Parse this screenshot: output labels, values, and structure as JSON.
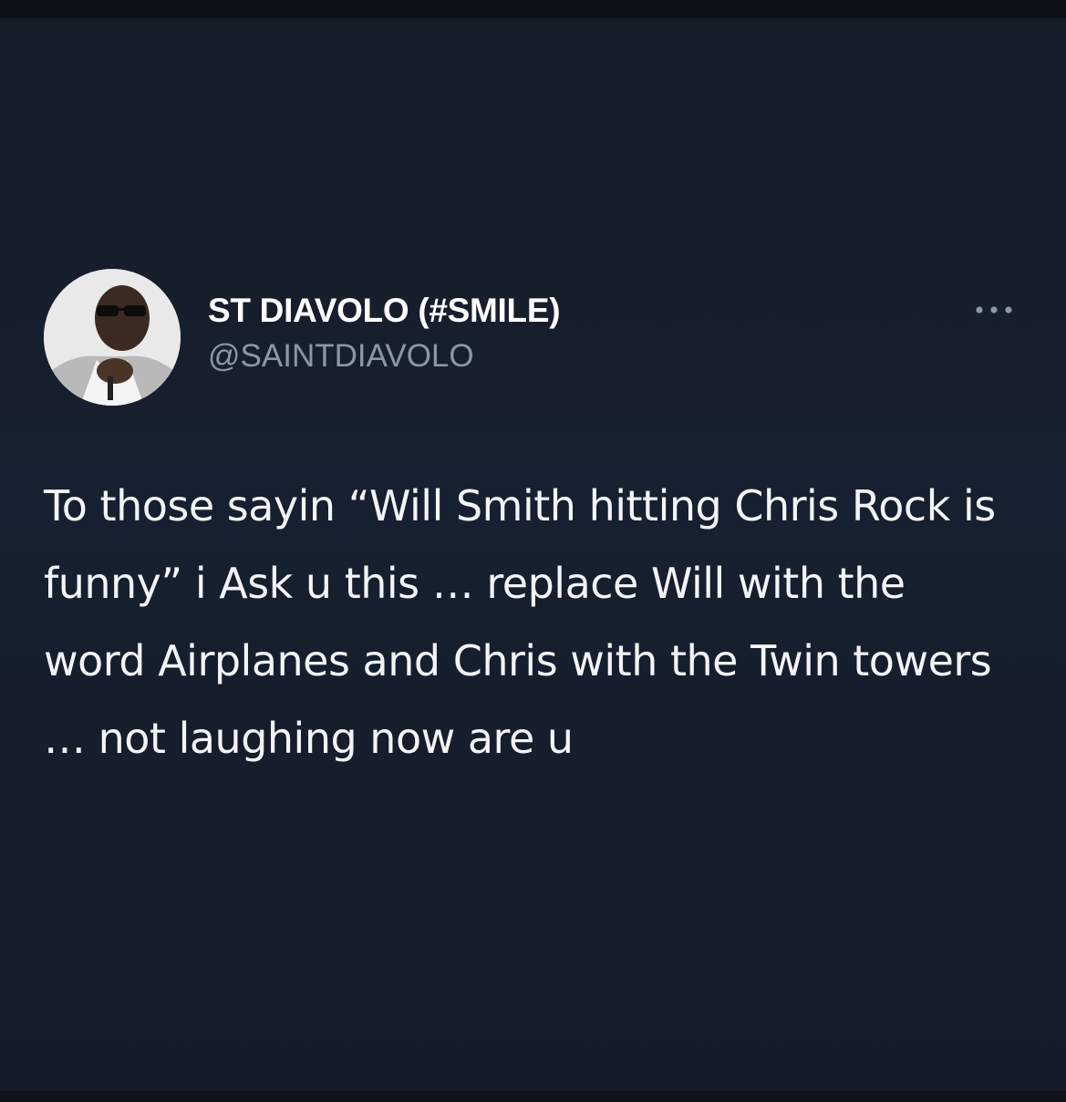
{
  "tweet": {
    "display_name": "ST DIAVOLO (#SMILE)",
    "handle": "@SAINTDIAVOLO",
    "text": "To those sayin “Will Smith hitting Chris Rock is funny” i Ask u this … replace Will with the word Airplanes and Chris with the Twin towers … not laughing now are u",
    "avatar_icon": "profile-photo",
    "more_icon": "more-options-icon"
  },
  "colors": {
    "background": "#172030",
    "text_primary": "#ffffff",
    "text_secondary": "#8b97a6"
  }
}
